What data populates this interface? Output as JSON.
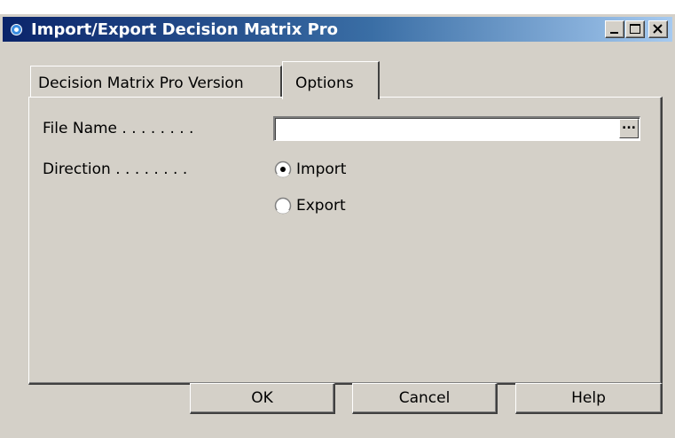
{
  "window": {
    "title": "Import/Export Decision Matrix Pro",
    "titlebar_colors": {
      "start": "#0a246a",
      "end": "#a6caf0"
    },
    "caption_buttons": [
      "minimize-icon",
      "maximize-icon",
      "close-icon"
    ]
  },
  "tabs": [
    {
      "label": "Decision Matrix Pro Version",
      "active": false
    },
    {
      "label": "Options",
      "active": true
    }
  ],
  "form": {
    "file_name": {
      "label": "File Name . . . . . . . .",
      "value": "",
      "browse_label": "..."
    },
    "direction": {
      "label": "Direction . . . . . . . .",
      "options": [
        {
          "label": "Import",
          "checked": true
        },
        {
          "label": "Export",
          "checked": false
        }
      ]
    }
  },
  "buttons": {
    "ok": "OK",
    "cancel": "Cancel",
    "help": "Help"
  }
}
